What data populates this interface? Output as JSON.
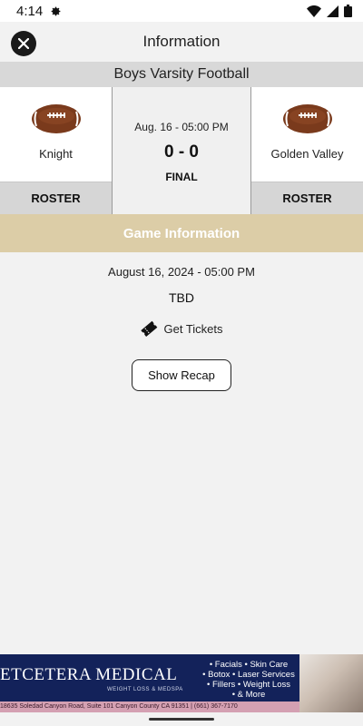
{
  "status_bar": {
    "time": "4:14",
    "icons": [
      "gear-icon",
      "wifi-icon",
      "signal-icon",
      "battery-icon"
    ]
  },
  "header": {
    "title": "Information",
    "close_icon": "close-icon"
  },
  "sport": "Boys Varsity Football",
  "game": {
    "home_team": {
      "name": "Knight",
      "roster_label": "ROSTER",
      "icon": "football-icon"
    },
    "away_team": {
      "name": "Golden Valley",
      "roster_label": "ROSTER",
      "icon": "football-icon"
    },
    "date_short": "Aug. 16 - 05:00 PM",
    "score": "0 - 0",
    "status": "FINAL"
  },
  "info": {
    "banner_title": "Game Information",
    "date_full": "August 16, 2024 - 05:00 PM",
    "venue": "TBD",
    "tickets_label": "Get Tickets",
    "recap_label": "Show Recap"
  },
  "ad": {
    "brand": "ETCETERA MEDICAL",
    "tagline": "WEIGHT LOSS & MEDSPA",
    "services": [
      "• Facials • Skin Care",
      "• Botox • Laser Services",
      "• Fillers • Weight Loss",
      "• & More"
    ],
    "footer": "18635 Soledad Canyon Road, Suite 101 Canyon County CA 91351 | (661) 367-7170"
  },
  "colors": {
    "banner": "#dccda7",
    "ad_background": "#13225a",
    "football": "#7a3a1c"
  }
}
